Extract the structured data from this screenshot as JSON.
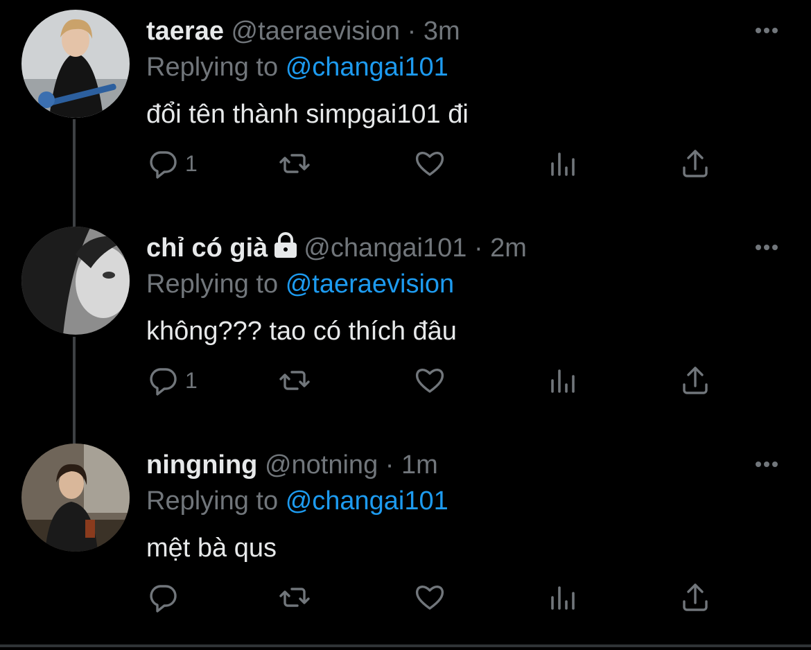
{
  "thread": [
    {
      "display_name": "taerae",
      "handle": "@taeraevision",
      "separator": "·",
      "time": "3m",
      "locked": false,
      "replying_prefix": "Replying to",
      "replying_to": "@changai101",
      "text": "đổi tên thành simpgai101 đi",
      "reply_count": "1",
      "avatar": "avatar-guitarist"
    },
    {
      "display_name": "chỉ có già",
      "handle": "@changai101",
      "separator": "·",
      "time": "2m",
      "locked": true,
      "replying_prefix": "Replying to",
      "replying_to": "@taeraevision",
      "text": "không??? tao có thích đâu",
      "reply_count": "1",
      "avatar": "avatar-girl-grayscale"
    },
    {
      "display_name": "ningning",
      "handle": "@notning",
      "separator": "·",
      "time": "1m",
      "locked": false,
      "replying_prefix": "Replying to",
      "replying_to": "@changai101",
      "text": "mệt bà qus",
      "reply_count": "",
      "avatar": "avatar-girl-cafe"
    }
  ],
  "icons": {
    "reply": "reply-icon",
    "retweet": "retweet-icon",
    "like": "like-icon",
    "analytics": "analytics-icon",
    "share": "share-icon",
    "more": "more-icon",
    "lock": "lock-icon"
  },
  "colors": {
    "background": "#000000",
    "text": "#e7e9ea",
    "secondary": "#71767b",
    "link": "#1d9bf0",
    "thread_line": "#3e4144"
  }
}
